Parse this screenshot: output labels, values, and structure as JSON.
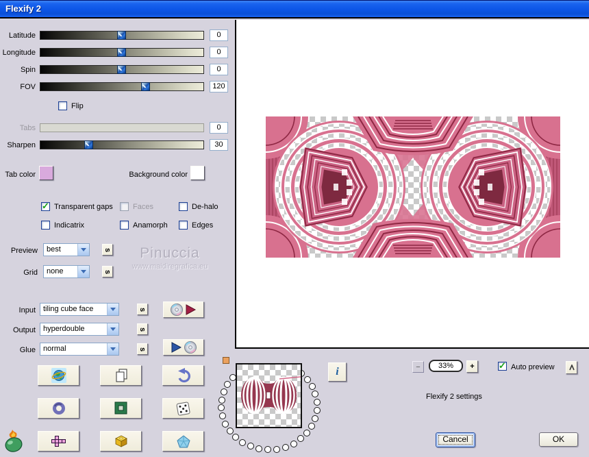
{
  "window": {
    "title": "Flexify 2"
  },
  "accent": {
    "titlebar_blue": "#0c55e6",
    "dialog_bg": "#d6d3de",
    "button_cream": "#f3f0e1",
    "check_green": "#18a018",
    "slider_thumb_blue": "#1a50a8",
    "preview_pink": "#d8718f"
  },
  "sliders": [
    {
      "label": "Latitude",
      "value": "0",
      "fraction": 0.5,
      "disabled": false
    },
    {
      "label": "Longitude",
      "value": "0",
      "fraction": 0.5,
      "disabled": false
    },
    {
      "label": "Spin",
      "value": "0",
      "fraction": 0.5,
      "disabled": false
    },
    {
      "label": "FOV",
      "value": "120",
      "fraction": 0.645,
      "disabled": false
    },
    {
      "label": "Tabs",
      "value": "0",
      "fraction": null,
      "disabled": true
    },
    {
      "label": "Sharpen",
      "value": "30",
      "fraction": 0.3,
      "disabled": false
    }
  ],
  "flip": {
    "label": "Flip",
    "checked": false
  },
  "color_pickers": {
    "tab_label": "Tab color",
    "tab_color": "#d9aadd",
    "bg_label": "Background color",
    "bg_color": "#ffffff"
  },
  "options": [
    {
      "label": "Transparent gaps",
      "checked": true,
      "disabled": false
    },
    {
      "label": "Faces",
      "checked": false,
      "disabled": true
    },
    {
      "label": "De-halo",
      "checked": false,
      "disabled": false
    },
    {
      "label": "Indicatrix",
      "checked": false,
      "disabled": false
    },
    {
      "label": "Anamorph",
      "checked": false,
      "disabled": false
    },
    {
      "label": "Edges",
      "checked": false,
      "disabled": false
    }
  ],
  "combos": {
    "preview": {
      "label": "Preview",
      "value": "best"
    },
    "grid": {
      "label": "Grid",
      "value": "none"
    },
    "input": {
      "label": "Input",
      "value": "tiling cube face"
    },
    "output": {
      "label": "Output",
      "value": "hyperdouble"
    },
    "glue": {
      "label": "Glue",
      "value": "normal"
    }
  },
  "s_button": "s",
  "watermark": {
    "line1": "Pinuccia",
    "line2": "www.maidiregrafica.eu"
  },
  "info_button": "i",
  "footer": {
    "zoom_out": "−",
    "zoom_value": "33%",
    "zoom_in": "+",
    "auto_preview": {
      "label": "Auto preview",
      "checked": true
    },
    "settings_text": "Flexify 2 settings",
    "cancel": "Cancel",
    "ok": "OK"
  }
}
